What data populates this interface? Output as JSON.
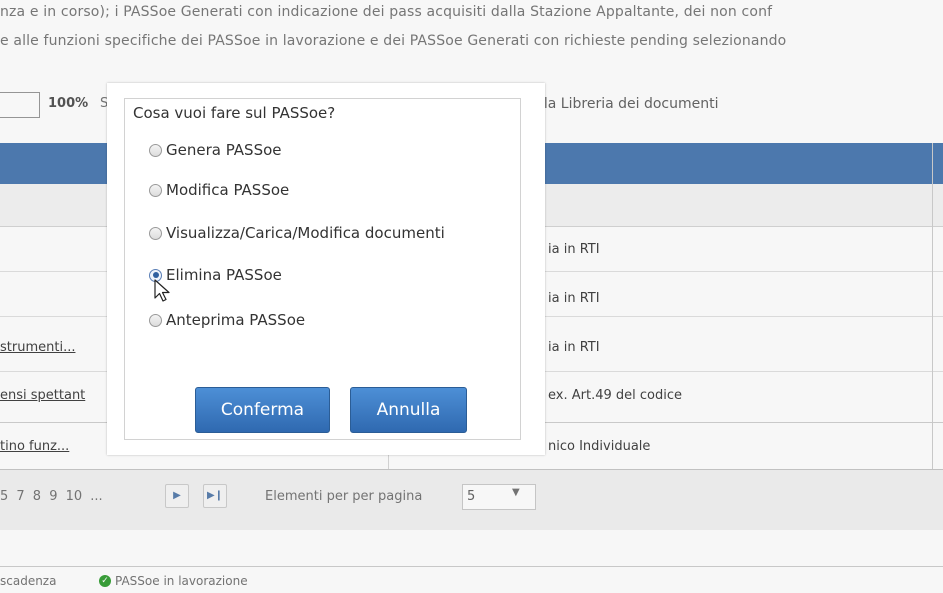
{
  "intro": {
    "line1": "nza e in corso); i PASSoe Generati con indicazione dei pass acquisiti dalla Stazione Appaltante, dei non conf",
    "line2": "e alle funzioni specifiche dei PASSoe in lavorazione e dei PASSoe Generati con richieste pending selezionando"
  },
  "toolbar": {
    "zoom": "100%",
    "zoom_suffix": "S",
    "library_text": "lla Libreria dei documenti"
  },
  "table": {
    "rows": [
      {
        "left": "",
        "right": "ia in RTI"
      },
      {
        "left": "",
        "right": "ia in RTI"
      },
      {
        "left": "strumenti...",
        "right": "ia in RTI"
      },
      {
        "left": "ensi spettant",
        "right": "ex. Art.49 del codice"
      },
      {
        "left": "tino funz...",
        "right": "nico Individuale"
      }
    ]
  },
  "pager": {
    "pages": "5  7  8  9  10  ...",
    "next_icon": "next-page-icon",
    "last_icon": "last-page-icon",
    "per_page_label": "Elementi per per pagina",
    "per_page_value": "5"
  },
  "legend": {
    "item1": "scadenza",
    "item2": "PASSoe in lavorazione",
    "item2_icon_color": "#3aa23a"
  },
  "dialog": {
    "question": "Cosa vuoi fare sul PASSoe?",
    "options": [
      {
        "label": "Genera PASSoe",
        "selected": false
      },
      {
        "label": "Modifica PASSoe",
        "selected": false
      },
      {
        "label": "Visualizza/Carica/Modifica documenti",
        "selected": false
      },
      {
        "label": "Elimina PASSoe",
        "selected": true
      },
      {
        "label": "Anteprima PASSoe",
        "selected": false
      }
    ],
    "confirm_label": "Conferma",
    "cancel_label": "Annulla"
  },
  "colors": {
    "header_blue": "#4f7cb3",
    "button_blue": "#3f7ec6"
  }
}
